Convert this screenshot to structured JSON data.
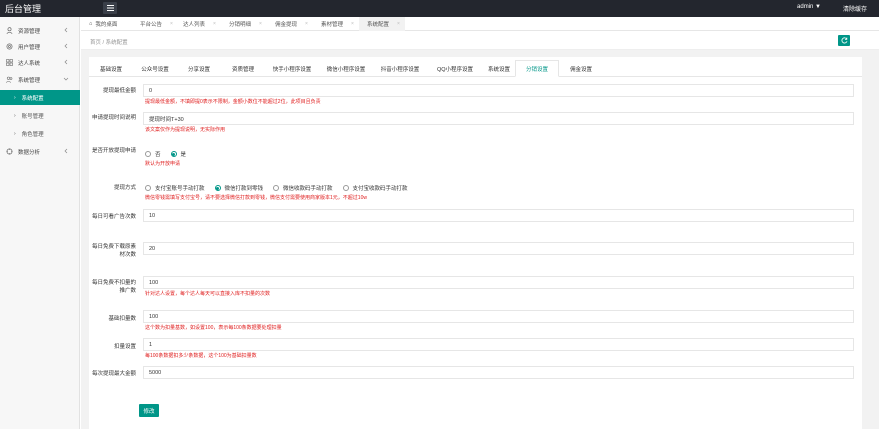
{
  "header": {
    "title": "后台管理",
    "user": "admin",
    "user_caret": "▼",
    "clear_cache": "清除缓存"
  },
  "sidebar": {
    "items": [
      {
        "label": "资源管理",
        "icon": "user-icon"
      },
      {
        "label": "用户管理",
        "icon": "gear-icon"
      },
      {
        "label": "达人系统",
        "icon": "grid-icon"
      },
      {
        "label": "系统管理",
        "icon": "users-icon"
      }
    ],
    "sub_items": [
      {
        "label": "系统配置",
        "active": true
      },
      {
        "label": "账号管理",
        "active": false
      },
      {
        "label": "角色管理",
        "active": false
      }
    ],
    "extra": {
      "label": "数据分析",
      "icon": "settings-icon"
    }
  },
  "tabs": [
    {
      "label": "我的桌面"
    },
    {
      "label": "平台公告"
    },
    {
      "label": "达人列表"
    },
    {
      "label": "分销明细"
    },
    {
      "label": "佣金提现"
    },
    {
      "label": "素材管理"
    },
    {
      "label": "系统配置"
    }
  ],
  "breadcrumb": "首页 / 系统配置",
  "settings_tabs": [
    "基础设置",
    "公众号设置",
    "分享设置",
    "资质管理",
    "快手小程序设置",
    "微信小程序设置",
    "抖音小程序设置",
    "QQ小程序设置",
    "系统设置",
    "分销设置",
    "佣金设置"
  ],
  "form": {
    "min_withdraw": {
      "label": "提现最低金额",
      "value": "0",
      "hint": "提现最低金额，不填即提0表示不限制，金额小数位不能超过2位，此项目且负责"
    },
    "withdraw_time": {
      "label": "申请提现时间说明",
      "value": "提现时间T+30",
      "hint": "该文案仅作为提现说明，无实际作用"
    },
    "manual_review": {
      "label": "是否开放提现申请",
      "options": [
        "否",
        "是"
      ],
      "hint": "默认为开放申请"
    },
    "withdraw_method": {
      "label": "提现方式",
      "options": [
        "支付宝账号手动打款",
        "微信打款到零钱",
        "微信收款码手动打款",
        "支付宝收款码手动打款"
      ],
      "hint": "微信零钱需填写支付宝号，请不要选择微信打款到零钱，微信支付需要使用商家版本1元，不超过10w"
    },
    "daily_ad": {
      "label": "每日可看广告次数",
      "value": "10"
    },
    "daily_download": {
      "label": "每日免费下载原素材次数",
      "value": "20"
    },
    "daily_watermark": {
      "label": "每日免费不扣量的推广数",
      "value": "100",
      "hint": "针对达人设置，每个达人每天可以直接入库不扣量的次数"
    },
    "base_deduct": {
      "label": "基础扣量数",
      "value": "100",
      "hint": "这个数为扣量基数，如设置100，表示每100条数据要处理扣量"
    },
    "deduct_setting": {
      "label": "扣量设置",
      "value": "1",
      "hint": "每100条数据扣多少条数据，这个100为基础扣量数"
    },
    "max_withdraw": {
      "label": "每次提现最大金额",
      "value": "5000"
    },
    "submit_label": "修改"
  }
}
